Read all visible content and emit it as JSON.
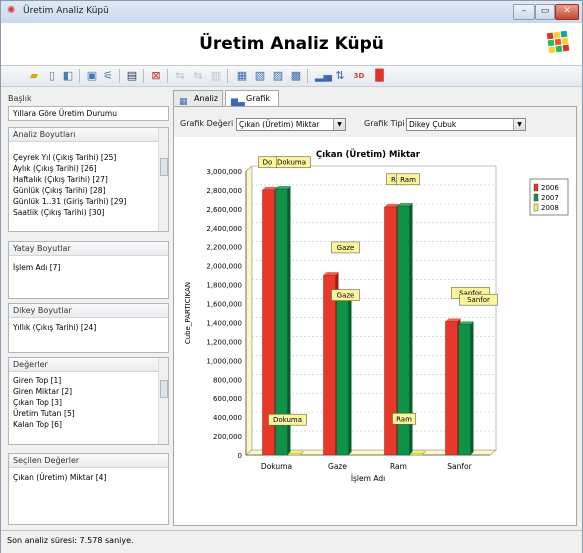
{
  "window": {
    "title": "Üretim Analiz Küpü",
    "buttons": {
      "minimize": "–",
      "maximize": "▭",
      "close": "✕"
    }
  },
  "banner": {
    "title": "Üretim Analiz Küpü"
  },
  "toolbar": {
    "icons": [
      "open-folder-icon",
      "new-document-icon",
      "export-icon",
      "save-icon",
      "chart-settings-icon",
      "swap-axes-icon",
      "window-icon",
      "delete-icon",
      "cut-icon",
      "paste-icon",
      "copy-icon",
      "grid-icon",
      "layout-icon",
      "refresh-icon",
      "pivot-icon",
      "chart-type-icon",
      "flip-icon",
      "3d-icon",
      "colored-bars-icon"
    ],
    "label_3d": "3D"
  },
  "left": {
    "baslik_label": "Başlık",
    "baslik_value": "Yıllara Göre Üretim Durumu",
    "analiz": {
      "header": "Analiz Boyutları",
      "items": [
        "Çeyrek Yıl (Çıkış Tarihi) [25]",
        "Aylık (Çıkış Tarihi) [26]",
        "Haftalık (Çıkış Tarihi) [27]",
        "Günlük (Çıkış Tarihi) [28]",
        "Günlük 1..31 (Giriş Tarihi) [29]",
        "Saatlik (Çıkış Tarihi) [30]"
      ]
    },
    "yatay": {
      "header": "Yatay Boyutlar",
      "items": [
        "İşlem Adı [7]"
      ]
    },
    "dikey": {
      "header": "Dikey Boyutlar",
      "items": [
        "Yıllık (Çıkış Tarihi) [24]"
      ]
    },
    "degerler": {
      "header": "Değerler",
      "items": [
        "Giren Top [1]",
        "Giren Miktar [2]",
        "Çıkan Top [3]",
        "Üretim Tutarı [5]",
        "Kalan Top [6]"
      ]
    },
    "secilen": {
      "header": "Seçilen Değerler",
      "items": [
        "Çıkan (Üretim) Miktar [4]"
      ]
    }
  },
  "tabs": [
    {
      "label": "Analiz"
    },
    {
      "label": "Grafik"
    }
  ],
  "controls": {
    "grafik_degeri_label": "Grafik Değeri",
    "grafik_degeri_value": "Çıkan (Üretim) Miktar",
    "grafik_tipi_label": "Grafik Tipi",
    "grafik_tipi_value": "Dikey Çubuk"
  },
  "status": {
    "text": "Son analiz süresi: 7.578 saniye."
  },
  "colors": {
    "2006": "#e8382b",
    "2007": "#109148",
    "2008": "#f5ec6a",
    "accent": "#0a3a8a"
  },
  "chart_data": {
    "type": "bar",
    "title": "Çıkan (Üretim) Miktar",
    "xlabel": "İşlem Adı",
    "ylabel": "Cube_PARTICIKAN",
    "categories": [
      "Dokuma",
      "Gaze",
      "Ram",
      "Sanfor"
    ],
    "series": [
      {
        "name": "2006",
        "values": [
          2800000,
          1900000,
          2620000,
          1410000
        ]
      },
      {
        "name": "2007",
        "values": [
          2810000,
          1660000,
          2630000,
          1380000
        ]
      },
      {
        "name": "2008",
        "values": [
          15000,
          0,
          15000,
          0
        ]
      }
    ],
    "ylim": [
      0,
      3000000
    ],
    "yticks": [
      "0",
      "200,000",
      "400,000",
      "600,000",
      "800,000",
      "1,000,000",
      "1,200,000",
      "1,400,000",
      "1,600,000",
      "1,800,000",
      "2,000,000",
      "2,200,000",
      "2,400,000",
      "2,600,000",
      "2,800,000",
      "3,000,000"
    ],
    "annotations": [
      {
        "text": "Dokuma",
        "category": "Dokuma",
        "value": 2950000
      },
      {
        "text": "Do",
        "category": "Dokuma",
        "value": 2950000
      },
      {
        "text": "Gaze",
        "category": "Gaze",
        "value": 2050000
      },
      {
        "text": "Gaze",
        "category": "Gaze",
        "value": 1800000
      },
      {
        "text": "Ra",
        "category": "Ram",
        "value": 2770000
      },
      {
        "text": "Ram",
        "category": "Ram",
        "value": 2770000
      },
      {
        "text": "Sanfor",
        "category": "Sanfor",
        "value": 1570000
      },
      {
        "text": "Sanfor",
        "category": "Sanfor",
        "value": 1540000
      },
      {
        "text": "Dokuma",
        "category": "Dokuma",
        "value": 230000
      },
      {
        "text": "Ram",
        "category": "Ram",
        "value": 240000
      }
    ],
    "legend": "right",
    "grid": true
  }
}
